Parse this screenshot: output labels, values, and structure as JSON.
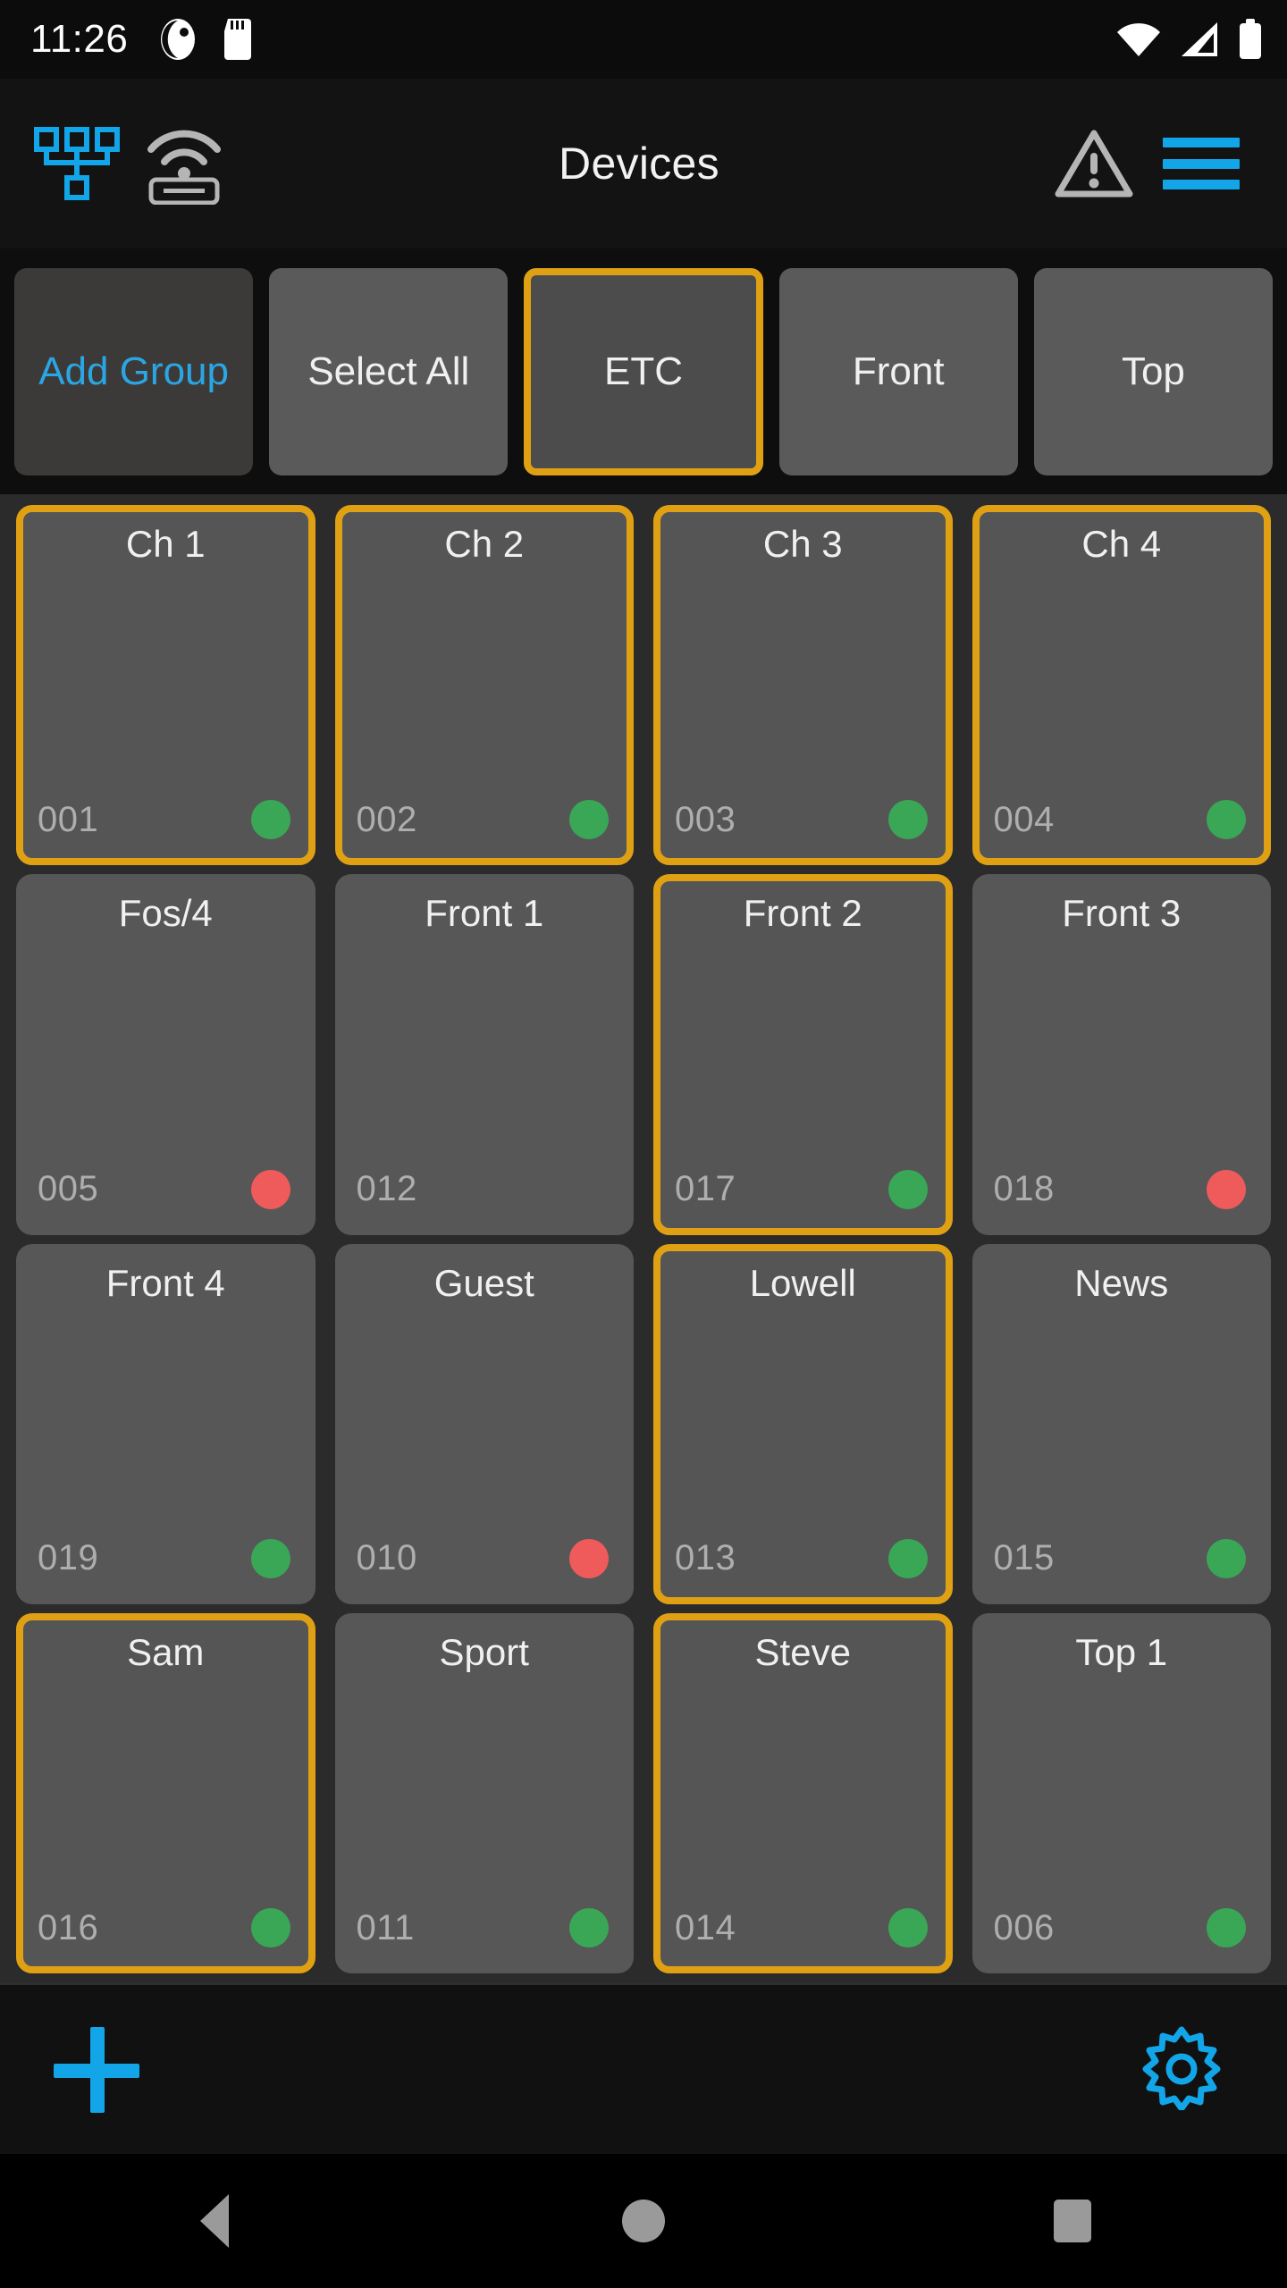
{
  "status_bar": {
    "time": "11:26",
    "left_icons": [
      "app-notification-icon",
      "sd-card-icon"
    ],
    "right_icons": [
      "wifi-icon",
      "cellular-signal-icon",
      "battery-icon"
    ]
  },
  "header": {
    "title": "Devices",
    "network_icon": "network-topology-icon",
    "wireless_icon": "wireless-router-icon",
    "warning_icon": "warning-triangle-icon",
    "menu_icon": "hamburger-menu-icon"
  },
  "group_bar": {
    "tabs": [
      {
        "label": "Add\nGroup",
        "style": "add",
        "selected": false
      },
      {
        "label": "Select\nAll",
        "style": "normal",
        "selected": false
      },
      {
        "label": "ETC",
        "style": "normal",
        "selected": true
      },
      {
        "label": "Front",
        "style": "normal",
        "selected": false
      },
      {
        "label": "Top",
        "style": "normal",
        "selected": false
      }
    ]
  },
  "devices": [
    {
      "name": "Ch 1",
      "id": "001",
      "status": "online",
      "selected": true
    },
    {
      "name": "Ch 2",
      "id": "002",
      "status": "online",
      "selected": true
    },
    {
      "name": "Ch 3",
      "id": "003",
      "status": "online",
      "selected": true
    },
    {
      "name": "Ch 4",
      "id": "004",
      "status": "online",
      "selected": true
    },
    {
      "name": "Fos/4",
      "id": "005",
      "status": "offline",
      "selected": false
    },
    {
      "name": "Front 1",
      "id": "012",
      "status": "none",
      "selected": false
    },
    {
      "name": "Front 2",
      "id": "017",
      "status": "online",
      "selected": true
    },
    {
      "name": "Front 3",
      "id": "018",
      "status": "offline",
      "selected": false
    },
    {
      "name": "Front 4",
      "id": "019",
      "status": "online",
      "selected": false
    },
    {
      "name": "Guest",
      "id": "010",
      "status": "offline",
      "selected": false
    },
    {
      "name": "Lowell",
      "id": "013",
      "status": "online",
      "selected": true
    },
    {
      "name": "News",
      "id": "015",
      "status": "online",
      "selected": false
    },
    {
      "name": "Sam",
      "id": "016",
      "status": "online",
      "selected": true
    },
    {
      "name": "Sport",
      "id": "011",
      "status": "online",
      "selected": false
    },
    {
      "name": "Steve",
      "id": "014",
      "status": "online",
      "selected": true
    },
    {
      "name": "Top 1",
      "id": "006",
      "status": "online",
      "selected": false
    }
  ],
  "bottom_bar": {
    "add_icon": "plus-icon",
    "settings_icon": "gear-icon"
  },
  "nav_bar": {
    "back": "back-triangle-icon",
    "home": "home-circle-icon",
    "recents": "recents-square-icon"
  },
  "colors": {
    "accent_blue": "#12a5e8",
    "selection_amber": "#dfa113",
    "status_online": "#3aa757",
    "status_offline": "#ef5b5b",
    "card_background": "#575757",
    "page_background": "#2b2b2b"
  }
}
